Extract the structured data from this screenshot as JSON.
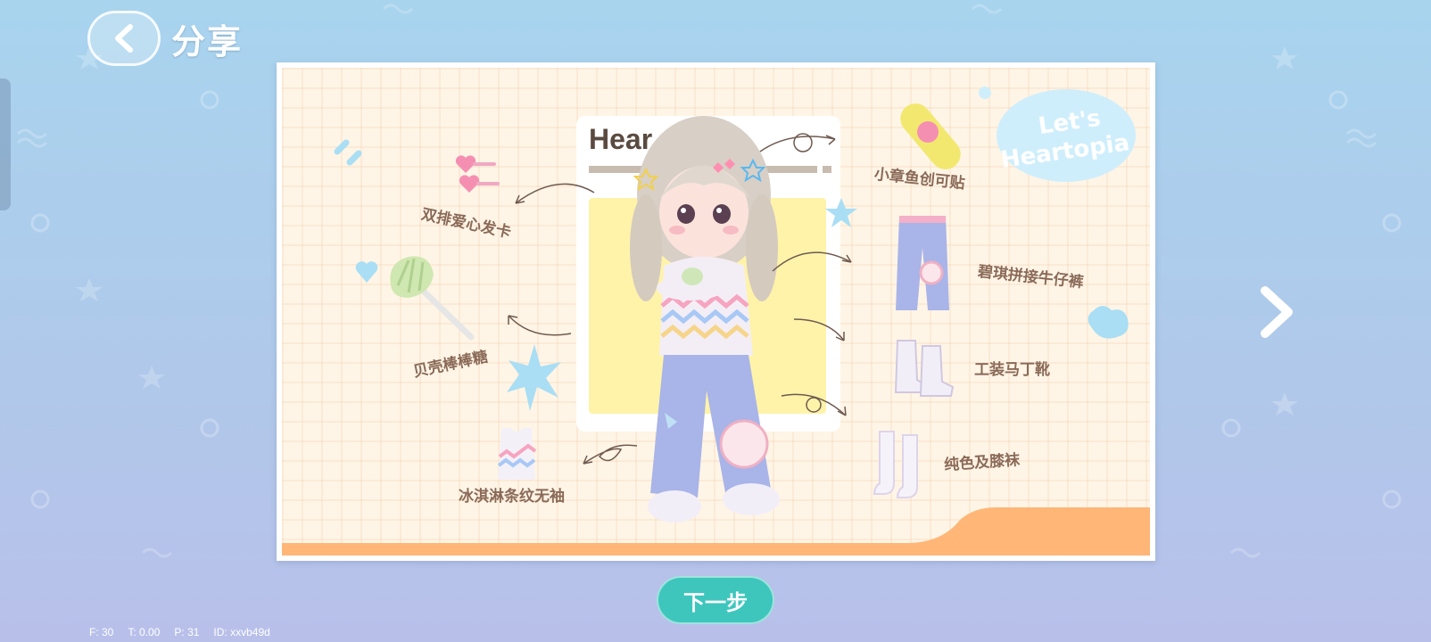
{
  "header": {
    "title": "分享",
    "back_icon": "chevron-left-icon"
  },
  "poster": {
    "title_partial": "Hear",
    "badge_text_line1": "Let's",
    "badge_text_line2": "Heartopia"
  },
  "outfit_items": [
    {
      "label": "双排爱心发卡",
      "icon": "heart-hairclip-icon"
    },
    {
      "label": "贝壳棒棒糖",
      "icon": "shell-lollipop-icon"
    },
    {
      "label": "冰淇淋条纹无袖",
      "icon": "striped-tank-icon"
    },
    {
      "label": "小章鱼创可贴",
      "icon": "octopus-bandage-icon"
    },
    {
      "label": "碧琪拼接牛仔裤",
      "icon": "patchwork-jeans-icon"
    },
    {
      "label": "工装马丁靴",
      "icon": "martin-boots-icon"
    },
    {
      "label": "纯色及膝袜",
      "icon": "knee-socks-icon"
    }
  ],
  "footer": {
    "next_label": "下一步",
    "next_arrow_icon": "chevron-right-icon"
  },
  "debug": {
    "f": "F: 30",
    "t": "T: 0.00",
    "p": "P: 31",
    "id": "ID: xxvb49d"
  },
  "colors": {
    "accent_teal": "#3ec6bd",
    "card_bg": "#fff5e6",
    "orange_band": "#ffb677",
    "label_brown": "#8a6a58"
  }
}
